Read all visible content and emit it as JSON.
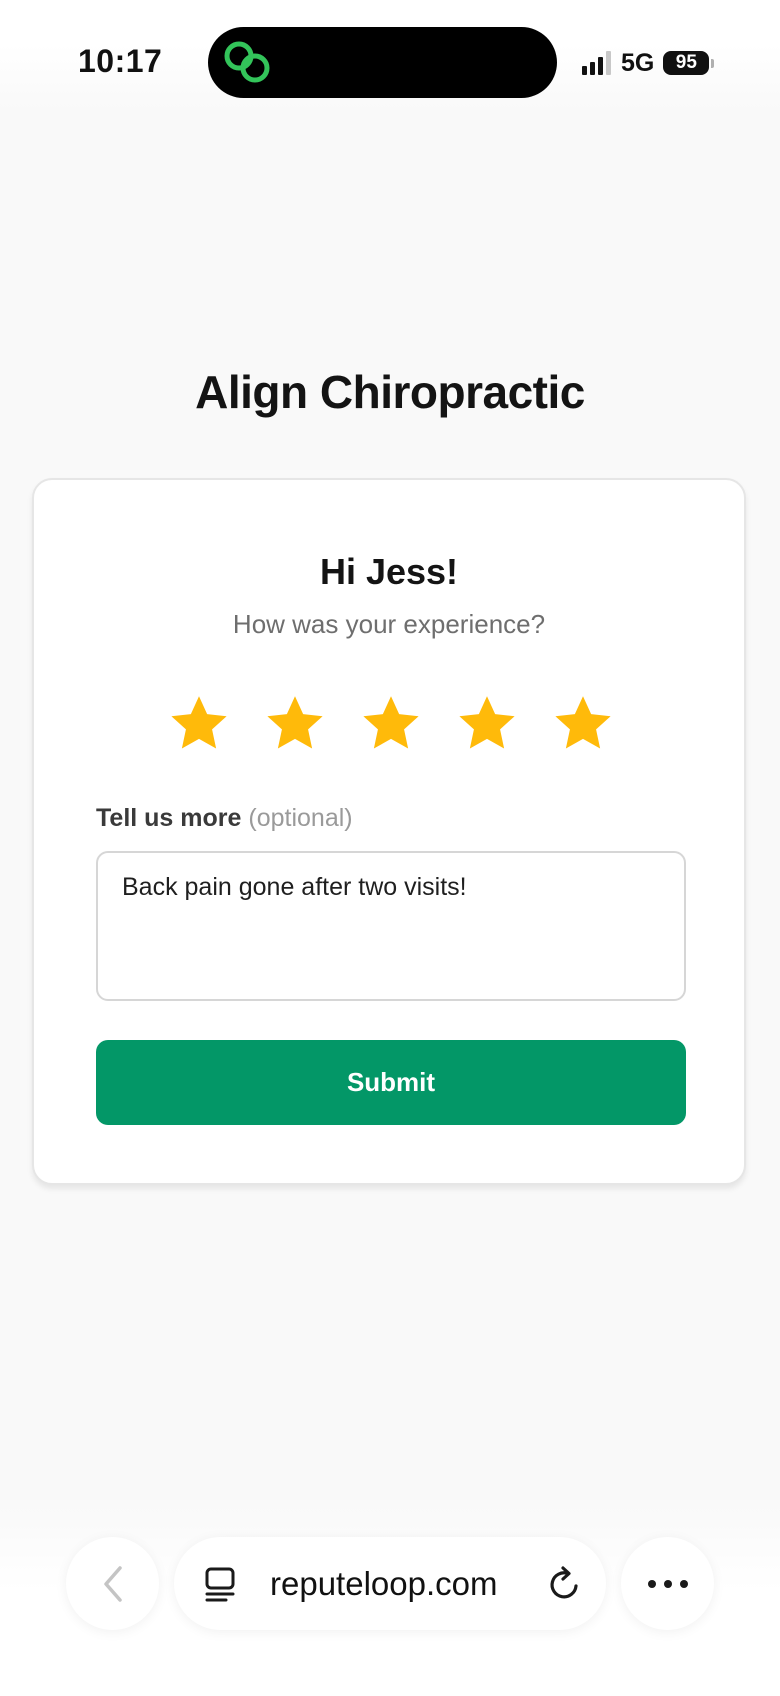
{
  "status_bar": {
    "time": "10:17",
    "network": "5G",
    "battery_level": "95",
    "signal_strength_bars": 3,
    "island_app_icon": "linked-rings-icon"
  },
  "page": {
    "business_name": "Align Chiropractic"
  },
  "review_card": {
    "greeting": "Hi Jess!",
    "prompt": "How was your experience?",
    "rating": 5,
    "rating_max": 5,
    "star_color": "#FFBA0A",
    "comment_label": "Tell us more",
    "comment_optional": "(optional)",
    "comment_value": "Back pain gone after two visits!",
    "submit_label": "Submit",
    "submit_color": "#039767"
  },
  "browser_bar": {
    "url": "reputeloop.com",
    "back_icon": "chevron-left-icon",
    "tabs_icon": "tabs-icon",
    "reload_icon": "reload-icon",
    "more_icon": "more-horizontal-icon"
  }
}
